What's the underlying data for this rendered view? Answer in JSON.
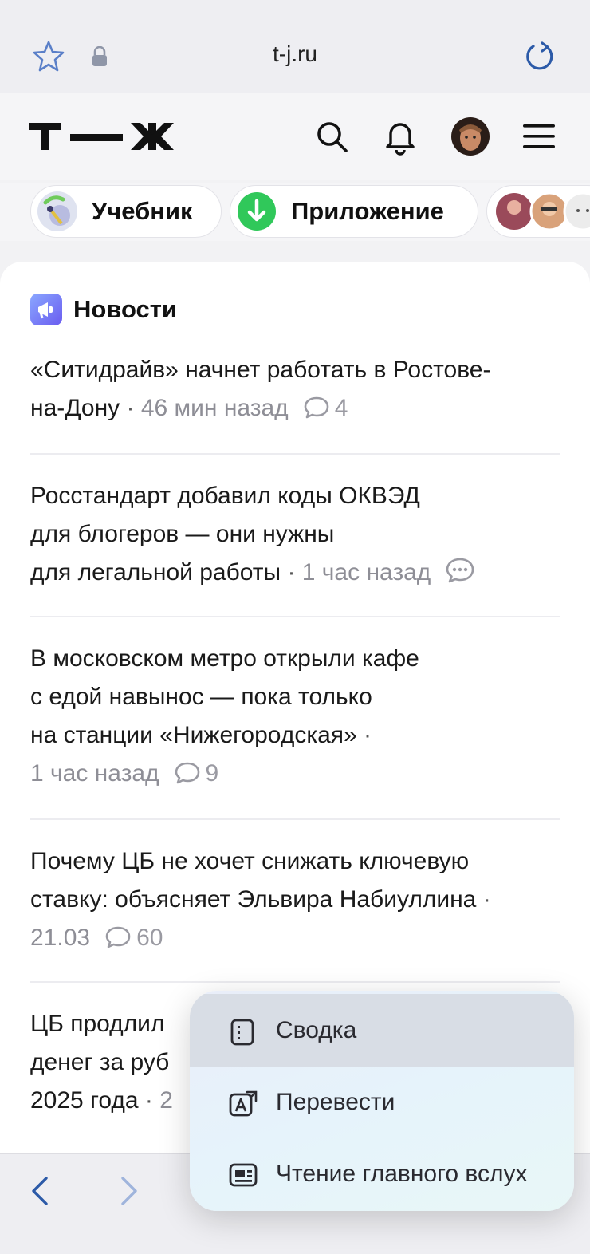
{
  "browser": {
    "url": "t-j.ru"
  },
  "site": {
    "logo_text": "Т—Ж"
  },
  "chips": [
    {
      "label": "Учебник"
    },
    {
      "label": "Приложение"
    }
  ],
  "news": {
    "title": "Новости",
    "items": [
      {
        "lines": [
          "«Ситидрайв» начнет работать в Ростове-",
          "на-Дону"
        ],
        "time": "46 мин назад",
        "comments": "4"
      },
      {
        "lines": [
          "Росстандарт добавил коды ОКВЭД",
          "для блогеров — они нужны",
          "для легальной работы"
        ],
        "time": "1 час назад",
        "comments": ""
      },
      {
        "lines": [
          "В московском метро открыли кафе",
          "с едой навынос — пока только",
          "на станции «Нижегородская»"
        ],
        "time": "1 час назад",
        "comments": "9"
      },
      {
        "lines": [
          "Почему ЦБ не хочет снижать ключевую",
          "ставку: объясняет Эльвира Набиуллина"
        ],
        "time": "21.03",
        "comments": "60"
      },
      {
        "lines": [
          "ЦБ продлил",
          "денег за руб",
          "2025 года"
        ],
        "time": "2",
        "comments": ""
      }
    ]
  },
  "popup_menu": {
    "items": [
      {
        "label": "Сводка",
        "icon": "summary-icon",
        "active": true
      },
      {
        "label": "Перевести",
        "icon": "translate-icon",
        "active": false
      },
      {
        "label": "Чтение главного вслух",
        "icon": "read-aloud-icon",
        "active": false
      }
    ]
  },
  "colors": {
    "accent_blue": "#2f6fe0",
    "meta_gray": "#8e8e96",
    "chip_green": "#30c85a"
  }
}
